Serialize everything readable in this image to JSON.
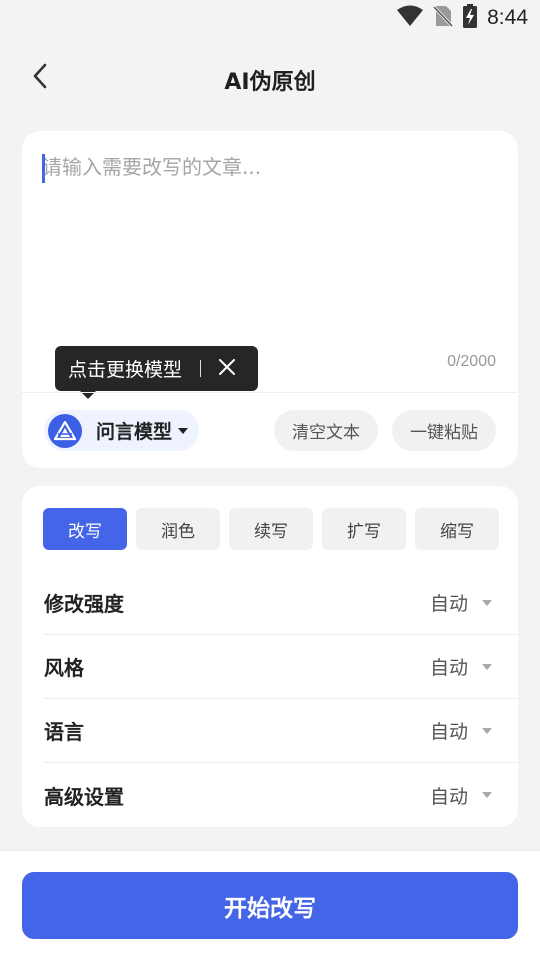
{
  "status_bar": {
    "time": "8:44",
    "icons": [
      "wifi-icon",
      "no-sim-icon",
      "battery-charging-icon"
    ]
  },
  "header": {
    "title": "AI伪原创",
    "back_icon": "chevron-left-icon"
  },
  "input": {
    "placeholder": "请输入需要改写的文章...",
    "value": "",
    "char_count": "0/2000"
  },
  "tooltip": {
    "text": "点击更换模型",
    "close_icon": "close-icon"
  },
  "model": {
    "label": "问言模型",
    "logo_icon": "model-logo-icon"
  },
  "actions": {
    "clear_label": "清空文本",
    "paste_label": "一键粘贴"
  },
  "modes": [
    {
      "label": "改写",
      "active": true
    },
    {
      "label": "润色",
      "active": false
    },
    {
      "label": "续写",
      "active": false
    },
    {
      "label": "扩写",
      "active": false
    },
    {
      "label": "缩写",
      "active": false
    }
  ],
  "settings": [
    {
      "label": "修改强度",
      "value": "自动"
    },
    {
      "label": "风格",
      "value": "自动"
    },
    {
      "label": "语言",
      "value": "自动"
    },
    {
      "label": "高级设置",
      "value": "自动"
    }
  ],
  "submit": {
    "label": "开始改写"
  },
  "colors": {
    "accent": "#4565e8",
    "background": "#f2f3f5",
    "card": "#ffffff",
    "tooltip": "#262626"
  }
}
